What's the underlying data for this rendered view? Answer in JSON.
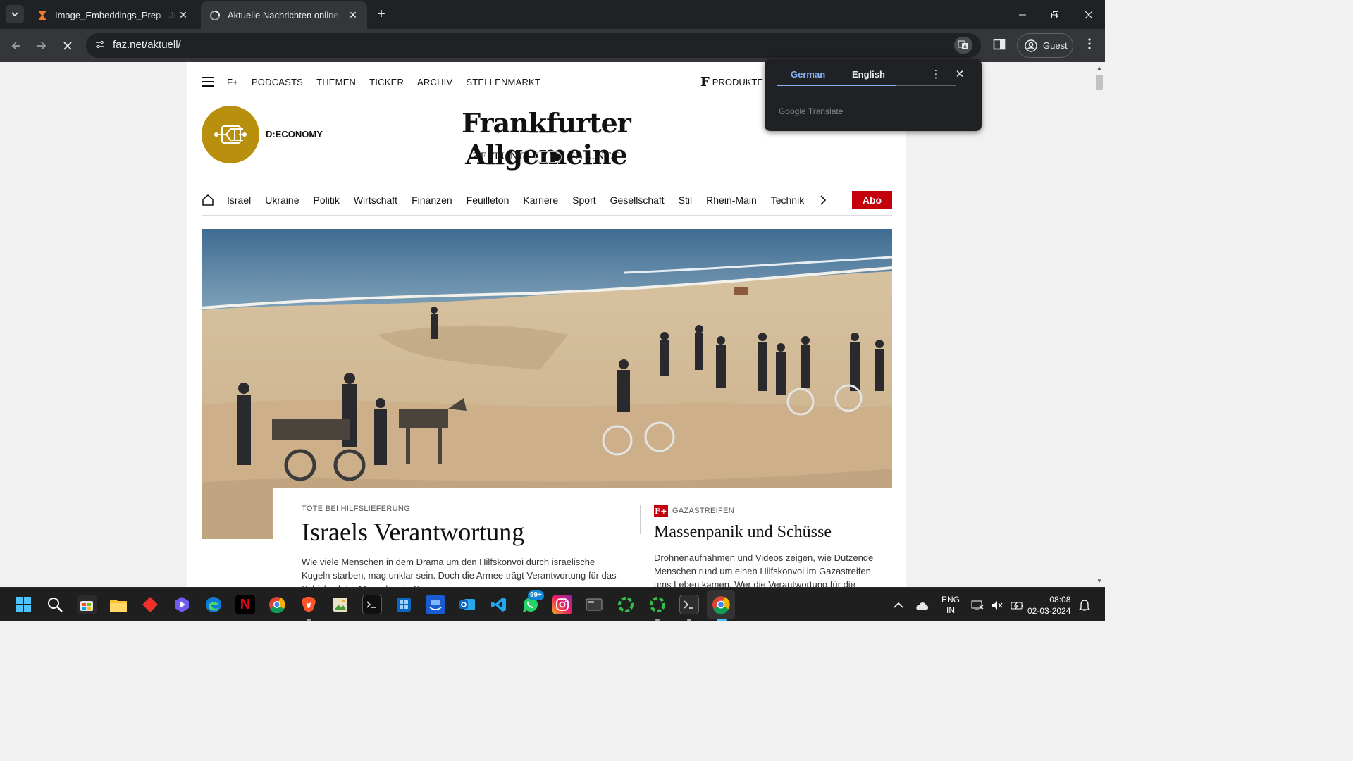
{
  "browser": {
    "tabs": [
      {
        "title": "Image_Embeddings_Prep - Jupyter",
        "active": false
      },
      {
        "title": "Aktuelle Nachrichten online - FAZ",
        "active": true
      }
    ],
    "url": "faz.net/aktuell/",
    "guest_label": "Guest"
  },
  "translate_popup": {
    "source_lang": "German",
    "target_lang": "English",
    "brand": "Google Translate"
  },
  "faz": {
    "top_nav": [
      "F+",
      "PODCASTS",
      "THEMEN",
      "TICKER",
      "ARCHIV",
      "STELLENMARKT"
    ],
    "produkte_label": "PRODUKTE",
    "produkte_glyph": "F",
    "deco_label": "D:ECONOMY",
    "masthead": "Frankfurter Allgemeine",
    "sub_left": "ZEITUNG",
    "sub_right": "FAZ.NET",
    "sections": [
      "Israel",
      "Ukraine",
      "Politik",
      "Wirtschaft",
      "Finanzen",
      "Feuilleton",
      "Karriere",
      "Sport",
      "Gesellschaft",
      "Stil",
      "Rhein-Main",
      "Technik"
    ],
    "abo_label": "Abo",
    "lead_story": {
      "kicker": "TOTE BEI HILFSLIEFERUNG",
      "headline": "Israels Verantwortung",
      "teaser": "Wie viele Menschen in dem Drama um den Hilfskonvoi durch israelische Kugeln starben, mag unklar sein. Doch die Armee trägt Verantwortung für das Schicksal der Menschen in Gaza."
    },
    "second_story": {
      "badge": "F+",
      "kicker": "GAZASTREIFEN",
      "headline": "Massenpanik und Schüsse",
      "teaser": "Drohnenaufnahmen und Videos zeigen, wie Dutzende Menschen rund um einen Hilfskonvoi im Gazastreifen ums Leben kamen. Wer die Verantwortung für die"
    }
  },
  "taskbar": {
    "whatsapp_badge": "99+",
    "lang_top": "ENG",
    "lang_bottom": "IN",
    "time": "08:08",
    "date": "02-03-2024"
  },
  "colors": {
    "faz_red": "#c4000d",
    "deco_gold": "#b8900e",
    "chrome_dark": "#202124",
    "chrome_toolbar": "#35363a",
    "translate_accent": "#8ab4f8"
  }
}
